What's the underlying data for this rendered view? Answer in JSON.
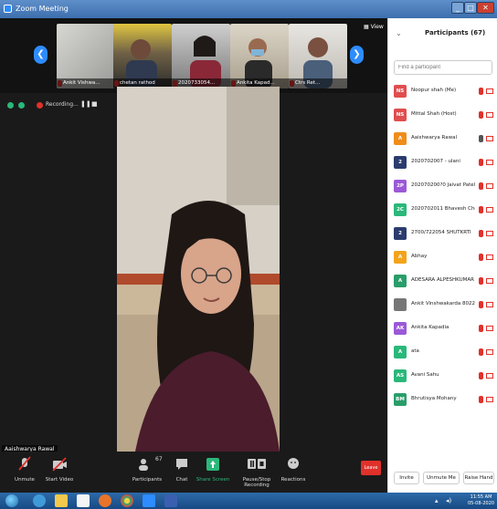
{
  "window": {
    "title": "Zoom Meeting",
    "min": "_",
    "max": "□",
    "close": "✕"
  },
  "strip": {
    "participants": [
      {
        "name": "Ankit Vishwa..."
      },
      {
        "name": "chetan rathod"
      },
      {
        "name": "2020733054..."
      },
      {
        "name": "Ankita Kapad..."
      },
      {
        "name": "Ctrs Ret..."
      }
    ],
    "view_label": "View"
  },
  "recording": {
    "label": "Recording..."
  },
  "speaker": {
    "name": "Aaishwarya Rawal"
  },
  "toolbar": {
    "unmute": "Unmute",
    "start_video": "Start Video",
    "participants": "Participants",
    "participants_count": "67",
    "chat": "Chat",
    "share_screen": "Share Screen",
    "record": "Pause/Stop Recording",
    "reactions": "Reactions",
    "leave": "Leave"
  },
  "panel": {
    "title": "Participants (67)",
    "search_placeholder": "Find a participant",
    "participants": [
      {
        "initials": "NS",
        "name": "Noopur shah (Me)",
        "color": "#e04e4e"
      },
      {
        "initials": "NS",
        "name": "Mittal Shah (Host)",
        "color": "#e04e4e"
      },
      {
        "initials": "A",
        "name": "Aaishwarya Rawal",
        "color": "#f08c1a"
      },
      {
        "initials": "2",
        "name": "2020702007 - ulani",
        "color": "#2a3b6e"
      },
      {
        "initials": "2P",
        "name": "202070200?0 Jaivat Patel",
        "color": "#9b59d6"
      },
      {
        "initials": "2C",
        "name": "2020702011 Bhavesh Choudhary",
        "color": "#2ab87a"
      },
      {
        "initials": "2",
        "name": "2700/722054 SHUTKRTI",
        "color": "#2a3b6e"
      },
      {
        "initials": "A",
        "name": "Abhay",
        "color": "#f2a41c"
      },
      {
        "initials": "A",
        "name": "ADESARA ALPESHKUMAR JAGDI...",
        "color": "#2a9d6a"
      },
      {
        "initials": "",
        "name": "Ankit Vinshwakarda 8022",
        "color": "#777777"
      },
      {
        "initials": "AK",
        "name": "Ankita Kapadia",
        "color": "#9b59d6"
      },
      {
        "initials": "A",
        "name": "ata",
        "color": "#2ab87a"
      },
      {
        "initials": "AS",
        "name": "Avani Sahu",
        "color": "#2ab87a"
      },
      {
        "initials": "BM",
        "name": "Bhrutisya Mohany",
        "color": "#2a9d6a"
      }
    ],
    "invite": "Invite",
    "unmute_me": "Unmute Me",
    "raise_hand": "Raise Hand"
  },
  "taskbar": {
    "time": "11:55 AM",
    "date": "05-08-2020"
  }
}
